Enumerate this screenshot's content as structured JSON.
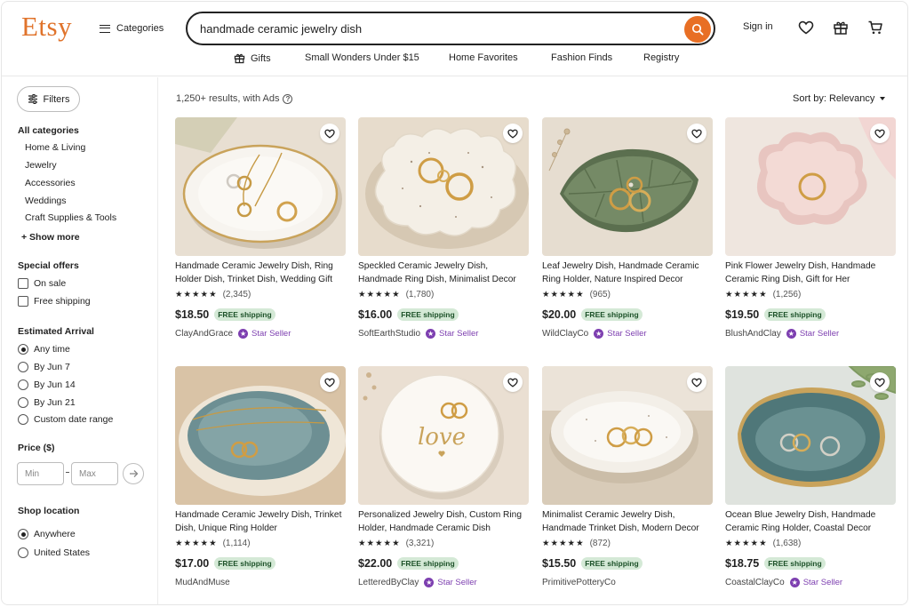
{
  "header": {
    "logo": "Etsy",
    "categories_label": "Categories",
    "search_value": "handmade ceramic jewelry dish",
    "signin_label": "Sign in"
  },
  "subnav": [
    "Gifts",
    "Small Wonders Under $15",
    "Home Favorites",
    "Fashion Finds",
    "Registry"
  ],
  "sidebar": {
    "filters_label": "Filters",
    "all_categories_label": "All categories",
    "categories": [
      "Home & Living",
      "Jewelry",
      "Accessories",
      "Weddings",
      "Craft Supplies & Tools"
    ],
    "show_more": "+ Show more",
    "special_offers_label": "Special offers",
    "special_offers": [
      "On sale",
      "Free shipping"
    ],
    "arrival_label": "Estimated Arrival",
    "arrival_options": [
      "Any time",
      "By Jun 7",
      "By Jun 14",
      "By Jun 21",
      "Custom date range"
    ],
    "arrival_selected": "Any time",
    "price_label": "Price ($)",
    "price_min_placeholder": "Min",
    "price_max_placeholder": "Max",
    "location_label": "Shop location",
    "location_options": [
      "Anywhere",
      "United States"
    ],
    "location_selected": "Anywhere"
  },
  "main": {
    "results_text": "1,250+ results, with Ads",
    "sort_label": "Sort by: Relevancy"
  },
  "products": [
    {
      "title": "Handmade Ceramic Jewelry Dish, Ring Holder Dish, Trinket Dish, Wedding Gift",
      "stars": "★★★★★",
      "reviews": "(2,345)",
      "price": "$18.50",
      "shipping": "FREE shipping",
      "shop": "ClayAndGrace",
      "star_seller": "Star Seller"
    },
    {
      "title": "Speckled Ceramic Jewelry Dish, Handmade Ring Dish, Minimalist Decor",
      "stars": "★★★★★",
      "reviews": "(1,780)",
      "price": "$16.00",
      "shipping": "FREE shipping",
      "shop": "SoftEarthStudio",
      "star_seller": "Star Seller"
    },
    {
      "title": "Leaf Jewelry Dish, Handmade Ceramic Ring Holder, Nature Inspired Decor",
      "stars": "★★★★★",
      "reviews": "(965)",
      "price": "$20.00",
      "shipping": "FREE shipping",
      "shop": "WildClayCo",
      "star_seller": "Star Seller"
    },
    {
      "title": "Pink Flower Jewelry Dish, Handmade Ceramic Ring Dish, Gift for Her",
      "stars": "★★★★★",
      "reviews": "(1,256)",
      "price": "$19.50",
      "shipping": "FREE shipping",
      "shop": "BlushAndClay",
      "star_seller": "Star Seller"
    },
    {
      "title": "Handmade Ceramic Jewelry Dish, Trinket Dish, Unique Ring Holder",
      "stars": "★★★★★",
      "reviews": "(1,114)",
      "price": "$17.00",
      "shipping": "FREE shipping",
      "shop": "MudAndMuse",
      "star_seller": ""
    },
    {
      "title": "Personalized Jewelry Dish, Custom Ring Holder, Handmade Ceramic Dish",
      "stars": "★★★★★",
      "reviews": "(3,321)",
      "price": "$22.00",
      "shipping": "FREE shipping",
      "shop": "LetteredByClay",
      "star_seller": "Star Seller",
      "dish_text": "love"
    },
    {
      "title": "Minimalist Ceramic Jewelry Dish, Handmade Trinket Dish, Modern Decor",
      "stars": "★★★★★",
      "reviews": "(872)",
      "price": "$15.50",
      "shipping": "FREE shipping",
      "shop": "PrimitivePotteryCo",
      "star_seller": ""
    },
    {
      "title": "Ocean Blue Jewelry Dish, Handmade Ceramic Ring Holder, Coastal Decor",
      "stars": "★★★★★",
      "reviews": "(1,638)",
      "price": "$18.75",
      "shipping": "FREE shipping",
      "shop": "CoastalClayCo",
      "star_seller": "Star Seller"
    }
  ],
  "colors": {
    "brand": "#e0732b",
    "search_button": "#e86f24",
    "free_shipping_bg": "#d4e9d6",
    "star_seller": "#7d3fb0"
  },
  "icons": [
    "menu-icon",
    "search-icon",
    "heart-icon",
    "gift-icon",
    "cart-icon",
    "sliders-icon",
    "question-icon",
    "arrow-right-icon",
    "star-seller-icon"
  ]
}
